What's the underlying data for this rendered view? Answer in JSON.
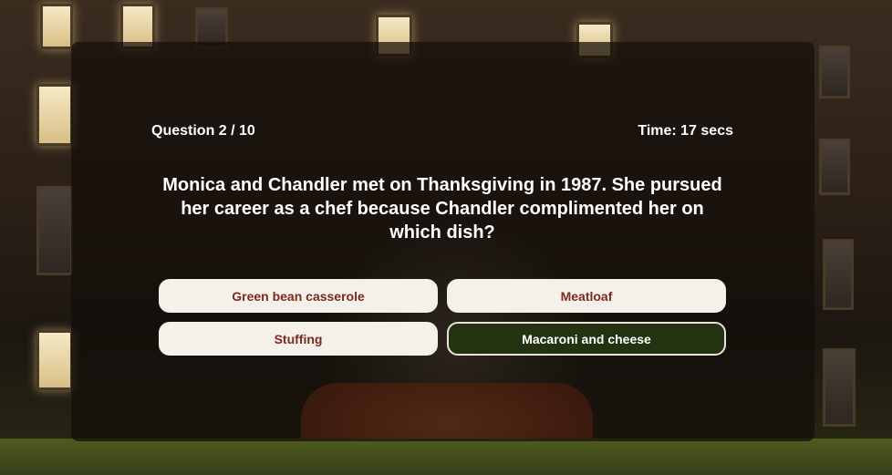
{
  "quiz": {
    "question_counter": "Question 2 / 10",
    "timer": "Time: 17 secs",
    "question_text": "Monica and Chandler met on Thanksgiving in 1987. She pursued her career as a chef because Chandler complimented her on which dish?",
    "answers": [
      {
        "label": "Green bean casserole",
        "selected": false
      },
      {
        "label": "Meatloaf",
        "selected": false
      },
      {
        "label": "Stuffing",
        "selected": false
      },
      {
        "label": "Macaroni and cheese",
        "selected": true
      }
    ],
    "colors": {
      "answer_bg": "#f4f1ea",
      "answer_text": "#7a2a20",
      "selected_bg": "#233311",
      "selected_text": "#ffffff"
    }
  }
}
